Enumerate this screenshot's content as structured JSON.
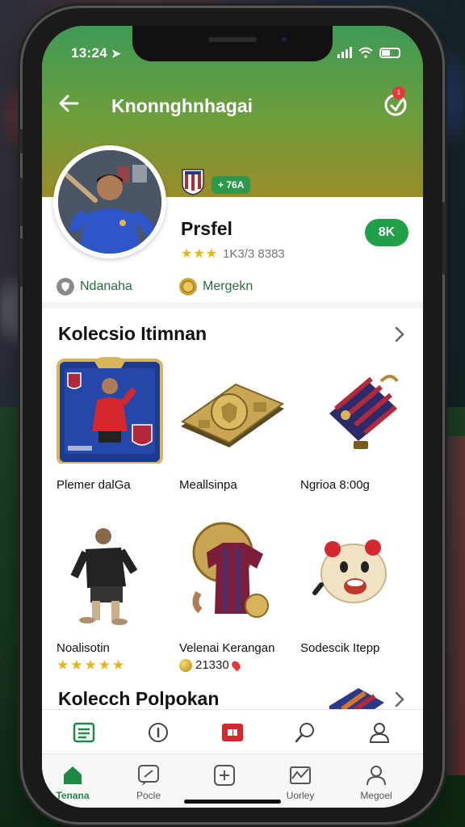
{
  "status_bar": {
    "time": "13:24"
  },
  "header": {
    "title": "Knonnghnhagai",
    "notification_count": "1"
  },
  "profile": {
    "level_badge": "+ 76A",
    "name": "Prsfel",
    "rating_stars": "★★★",
    "rating_text": "1K3/3 8383",
    "follow_label": "8K",
    "meta": [
      {
        "icon": "shield-icon",
        "label": "Ndanaha"
      },
      {
        "icon": "coin-icon",
        "label": "Mergekn"
      }
    ]
  },
  "sections": [
    {
      "title": "Kolecsio Itimnan",
      "items": [
        {
          "label": "Plemer dalGa",
          "icon": "player-card-icon"
        },
        {
          "label": "Meallsinpa",
          "icon": "gold-badge-icon"
        },
        {
          "label": "Ngrioa 8:00g",
          "icon": "scarf-bag-icon"
        },
        {
          "label": "Noalisotin",
          "icon": "black-jersey-player-icon",
          "stars": "★★★★★",
          "rating": 5
        },
        {
          "label": "Velenai Kerangan",
          "icon": "striped-jersey-icon",
          "price": "21330"
        },
        {
          "label": "Sodescik Itepp",
          "icon": "mascot-icon"
        }
      ]
    },
    {
      "title": "Kolecch Polpokan"
    }
  ],
  "tabbar_top": [
    {
      "icon": "list-icon"
    },
    {
      "icon": "info-icon"
    },
    {
      "icon": "video-icon"
    },
    {
      "icon": "search-icon"
    },
    {
      "icon": "user-icon"
    }
  ],
  "tabbar_bottom": [
    {
      "icon": "home-icon",
      "label": "Tenana",
      "active": true
    },
    {
      "icon": "edit-icon",
      "label": "Pocle"
    },
    {
      "icon": "plus-icon",
      "label": ""
    },
    {
      "icon": "mail-icon",
      "label": "Uorley"
    },
    {
      "icon": "user-icon",
      "label": "Megoel"
    }
  ],
  "colors": {
    "accent": "#21a04a",
    "header_top": "#3e9a55",
    "header_bottom": "#9a8d2a",
    "star": "#e6b418"
  }
}
